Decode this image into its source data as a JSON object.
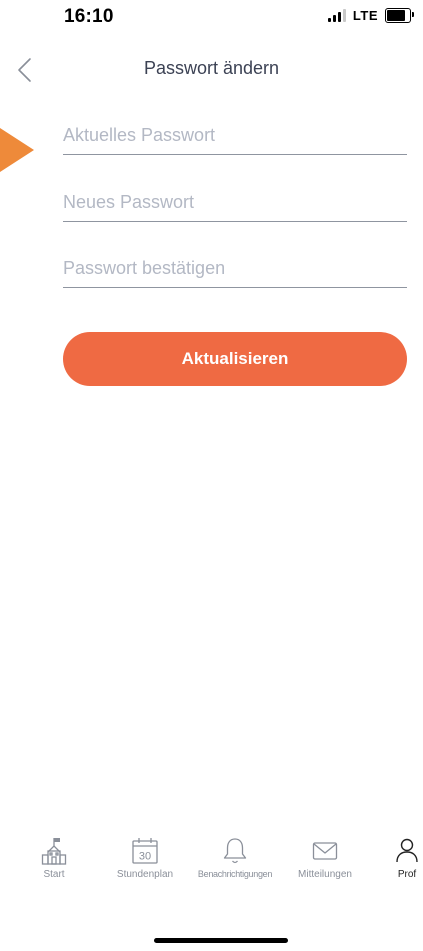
{
  "status": {
    "time": "16:10",
    "network": "LTE",
    "battery_level": 0.8
  },
  "header": {
    "title": "Passwort ändern",
    "back_icon": "chevron-left-icon"
  },
  "form": {
    "current_password_placeholder": "Aktuelles Passwort",
    "new_password_placeholder": "Neues Passwort",
    "confirm_password_placeholder": "Passwort bestätigen",
    "submit_label": "Aktualisieren"
  },
  "tabs": [
    {
      "label": "Start",
      "icon": "school-building-icon"
    },
    {
      "label": "Stundenplan",
      "icon": "calendar-icon",
      "icon_text": "30"
    },
    {
      "label": "Benachrichtigungen",
      "icon": "bell-icon"
    },
    {
      "label": "Mitteilungen",
      "icon": "envelope-icon"
    },
    {
      "label": "Prof",
      "icon": "person-icon"
    }
  ],
  "colors": {
    "accent": "#ef6a43",
    "pointer": "#ee8a3a",
    "title": "#3c4254",
    "placeholder": "#b3b8c4",
    "tab_label": "#8a8f99"
  }
}
